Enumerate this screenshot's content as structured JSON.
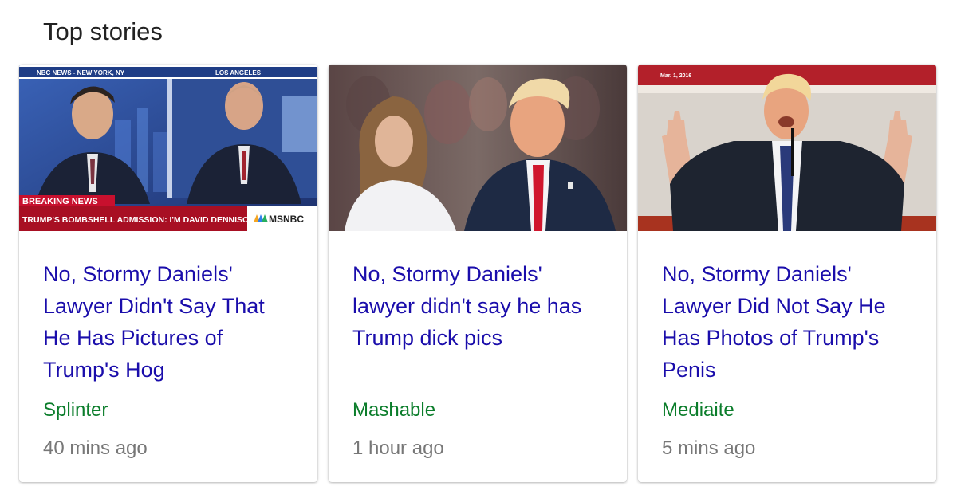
{
  "section": {
    "title": "Top stories"
  },
  "stories": [
    {
      "headline": "No, Stormy Daniels' Lawyer Didn't Say That He Has Pictures of Trump's Hog",
      "source": "Splinter",
      "time": "40 mins ago",
      "thumb": {
        "network": "NBC NEWS - NEW YORK, NY",
        "location": "LOS ANGELES",
        "banner_label": "BREAKING NEWS",
        "banner_text": "TRUMP'S BOMBSHELL ADMISSION: I'M DAVID DENNISON",
        "channel": "MSNBC"
      }
    },
    {
      "headline": "No, Stormy Daniels' lawyer didn't say he has Trump dick pics",
      "source": "Mashable",
      "time": "1 hour ago"
    },
    {
      "headline": "No, Stormy Daniels' Lawyer Did Not Say He Has Photos of Trump's Penis",
      "source": "Mediaite",
      "time": "5 mins ago",
      "thumb": {
        "date": "Mar. 1, 2016"
      }
    }
  ],
  "colors": {
    "headline": "#1a0dab",
    "source": "#0b7d2b",
    "time": "#777777"
  }
}
